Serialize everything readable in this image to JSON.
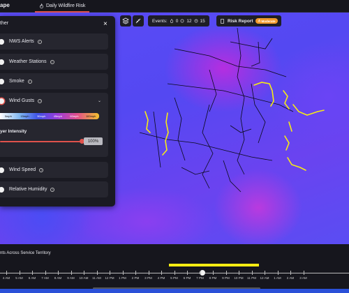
{
  "app": {
    "brand": "ape",
    "tab_label": "Daily Wildfire Risk"
  },
  "toolbar": {
    "events_label": "Events:",
    "events_fire": "0",
    "events_sun": "12",
    "events_alert": "15",
    "risk_report_label": "Risk Report",
    "risk_badge": "Moderate"
  },
  "panel": {
    "title": "ther",
    "close": "×",
    "layers": [
      {
        "label": "NWS Alerts",
        "on": false
      },
      {
        "label": "Weather Stations",
        "on": false
      },
      {
        "label": "Smoke",
        "on": false
      },
      {
        "label": "Wind Gusts",
        "on": true
      },
      {
        "label": "Wind Speed",
        "on": false
      },
      {
        "label": "Relative Humidity",
        "on": false
      }
    ],
    "wind_scale": [
      "0mph",
      "15mph",
      "30mph",
      "45mph",
      "60mph",
      "100mph"
    ],
    "layer_intensity_label": "yer Intensity",
    "layer_intensity_value": "100%",
    "layer_intensity_fraction": 1.0
  },
  "timeline": {
    "title": "nts Across Service Territory",
    "hours": [
      "4 AM",
      "5 AM",
      "6 AM",
      "7 AM",
      "8 AM",
      "9 AM",
      "10 AM",
      "11 AM",
      "12 PM",
      "1 PM",
      "2 PM",
      "3 PM",
      "4 PM",
      "5 PM",
      "6 PM",
      "7 PM",
      "8 PM",
      "9 PM",
      "10 PM",
      "11 PM",
      "12 AM",
      "1 AM",
      "2 AM",
      "3 AM"
    ],
    "current_hour": "5 PM"
  },
  "colors": {
    "accent": "#e0524c",
    "risk_badge": "#f19a2c",
    "highlight_lines": "#f7ec13"
  }
}
